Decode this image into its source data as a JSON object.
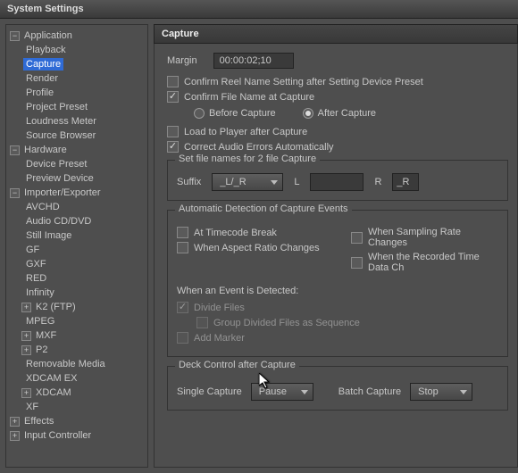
{
  "window_title": "System Settings",
  "panel_title": "Capture",
  "tree": {
    "application": {
      "label": "Application",
      "children": [
        "Playback",
        "Capture",
        "Render",
        "Profile",
        "Project Preset",
        "Loudness Meter",
        "Source Browser"
      ]
    },
    "hardware": {
      "label": "Hardware",
      "children": [
        "Device Preset",
        "Preview Device"
      ]
    },
    "importer": {
      "label": "Importer/Exporter",
      "children": [
        "AVCHD",
        "Audio CD/DVD",
        "Still Image",
        "GF",
        "GXF",
        "RED",
        "Infinity",
        "K2 (FTP)",
        "MPEG",
        "MXF",
        "P2",
        "Removable Media",
        "XDCAM EX",
        "XDCAM",
        "XF"
      ]
    },
    "effects": {
      "label": "Effects"
    },
    "input_controller": {
      "label": "Input Controller"
    }
  },
  "selected_tree_item": "Capture",
  "margin": {
    "label": "Margin",
    "value": "00:00:02;10"
  },
  "chk_confirm_reel": {
    "label": "Confirm Reel Name Setting after Setting Device Preset",
    "checked": false
  },
  "chk_confirm_filename": {
    "label": "Confirm File Name at Capture",
    "checked": true
  },
  "radio": {
    "before_label": "Before Capture",
    "after_label": "After Capture",
    "selected": "after"
  },
  "chk_load_player": {
    "label": "Load to Player after Capture",
    "checked": false
  },
  "chk_correct_audio": {
    "label": "Correct Audio Errors Automatically",
    "checked": true
  },
  "grp_filenames": {
    "title": "Set file names for 2 file Capture",
    "suffix_label": "Suffix",
    "suffix_value": "_L/_R",
    "L_label": "L",
    "L_value": "",
    "R_label": "R",
    "R_value": "_R"
  },
  "grp_auto": {
    "title": "Automatic Detection of Capture Events",
    "c1": {
      "label": "At Timecode Break",
      "checked": false
    },
    "c2": {
      "label": "When Aspect Ratio Changes",
      "checked": false
    },
    "c3": {
      "label": "When Sampling Rate Changes",
      "checked": false
    },
    "c4": {
      "label": "When the Recorded Time Data Ch",
      "checked": false
    },
    "event_label": "When an Event is Detected:",
    "divide": {
      "label": "Divide Files",
      "checked": true
    },
    "group_seq": {
      "label": "Group Divided Files as Sequence",
      "checked": false
    },
    "add_marker": {
      "label": "Add Marker",
      "checked": false
    }
  },
  "grp_deck": {
    "title": "Deck Control after Capture",
    "single_label": "Single Capture",
    "single_value": "Pause",
    "batch_label": "Batch Capture",
    "batch_value": "Stop"
  }
}
